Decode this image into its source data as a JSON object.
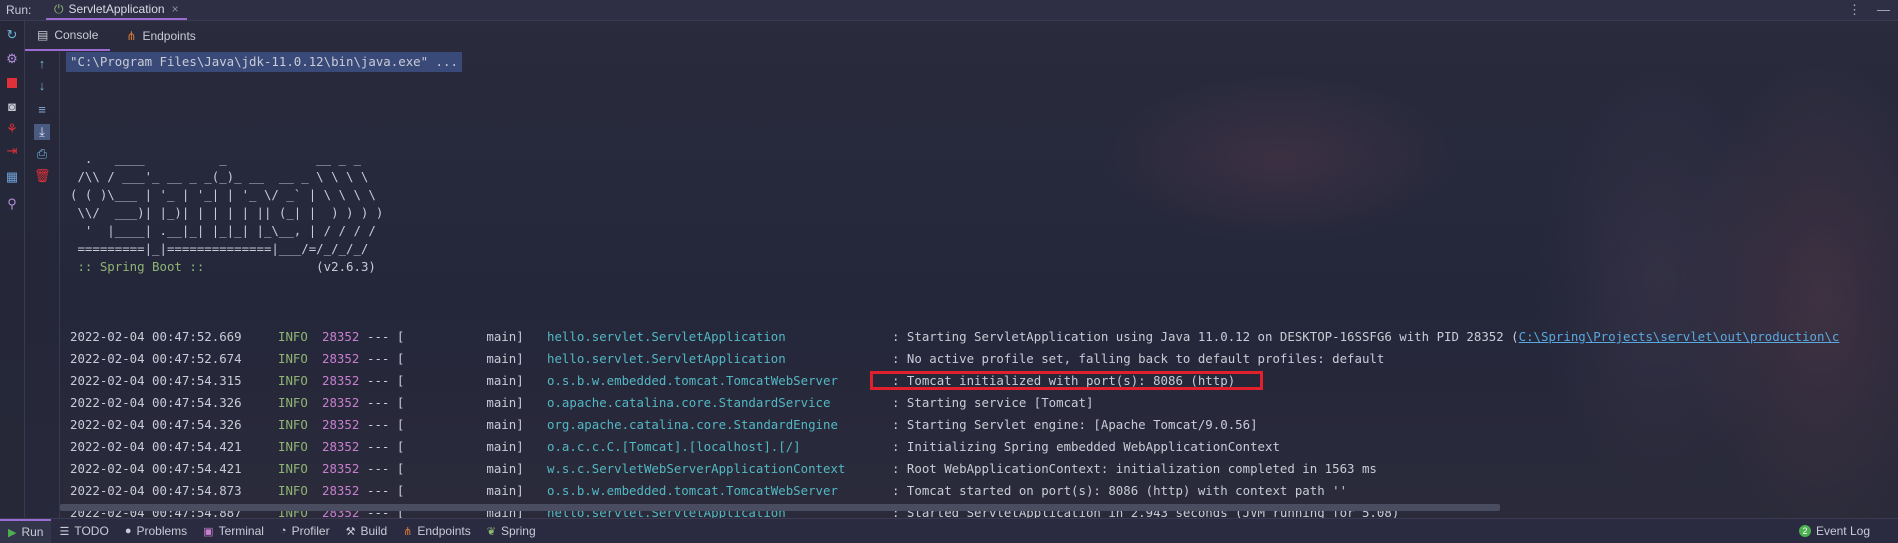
{
  "topbar": {
    "run_label": "Run:",
    "tab_title": "ServletApplication",
    "tab_close": "×",
    "menu_glyph": "⋮",
    "min_glyph": "—"
  },
  "subtabs": [
    {
      "label": "Console",
      "icon": "console-icon"
    },
    {
      "label": "Endpoints",
      "icon": "endpoints-icon"
    }
  ],
  "console": {
    "command": "\"C:\\Program Files\\Java\\jdk-11.0.12\\bin\\java.exe\" ...",
    "banner_art": "  .   ____          _            __ _ _\n /\\\\ / ___'_ __ _ _(_)_ __  __ _ \\ \\ \\ \\\n( ( )\\___ | '_ | '_| | '_ \\/ _` | \\ \\ \\ \\\n \\\\/  ___)| |_)| | | | | || (_| |  ) ) ) )\n  '  |____| .__|_| |_|_| |_\\__, | / / / /\n =========|_|==============|___/=/_/_/_/",
    "spring_label": " :: Spring Boot :: ",
    "spring_version": "              (v2.6.3)",
    "logs": [
      {
        "ts": "2022-02-04 00:47:52.669",
        "level": "INFO",
        "pid": "28352",
        "sep": "--- [           main]",
        "logger": "hello.servlet.ServletApplication",
        "msg": ": Starting ServletApplication using Java 11.0.12 on DESKTOP-16SSFG6 with PID 28352 (",
        "link": "C:\\Spring\\Projects\\servlet\\out\\production\\c"
      },
      {
        "ts": "2022-02-04 00:47:52.674",
        "level": "INFO",
        "pid": "28352",
        "sep": "--- [           main]",
        "logger": "hello.servlet.ServletApplication",
        "msg": ": No active profile set, falling back to default profiles: default"
      },
      {
        "ts": "2022-02-04 00:47:54.315",
        "level": "INFO",
        "pid": "28352",
        "sep": "--- [           main]",
        "logger": "o.s.b.w.embedded.tomcat.TomcatWebServer",
        "msg": ": Tomcat initialized with port(s): 8086 (http)"
      },
      {
        "ts": "2022-02-04 00:47:54.326",
        "level": "INFO",
        "pid": "28352",
        "sep": "--- [           main]",
        "logger": "o.apache.catalina.core.StandardService",
        "msg": ": Starting service [Tomcat]"
      },
      {
        "ts": "2022-02-04 00:47:54.326",
        "level": "INFO",
        "pid": "28352",
        "sep": "--- [           main]",
        "logger": "org.apache.catalina.core.StandardEngine",
        "msg": ": Starting Servlet engine: [Apache Tomcat/9.0.56]"
      },
      {
        "ts": "2022-02-04 00:47:54.421",
        "level": "INFO",
        "pid": "28352",
        "sep": "--- [           main]",
        "logger": "o.a.c.c.C.[Tomcat].[localhost].[/]",
        "msg": ": Initializing Spring embedded WebApplicationContext"
      },
      {
        "ts": "2022-02-04 00:47:54.421",
        "level": "INFO",
        "pid": "28352",
        "sep": "--- [           main]",
        "logger": "w.s.c.ServletWebServerApplicationContext",
        "msg": ": Root WebApplicationContext: initialization completed in 1563 ms"
      },
      {
        "ts": "2022-02-04 00:47:54.873",
        "level": "INFO",
        "pid": "28352",
        "sep": "--- [           main]",
        "logger": "o.s.b.w.embedded.tomcat.TomcatWebServer",
        "msg": ": Tomcat started on port(s): 8086 (http) with context path ''"
      },
      {
        "ts": "2022-02-04 00:47:54.887",
        "level": "INFO",
        "pid": "28352",
        "sep": "--- [           main]",
        "logger": "hello.servlet.ServletApplication",
        "msg": ": Started ServletApplication in 2.943 seconds (JVM running for 5.08)"
      }
    ]
  },
  "bottombar": {
    "tabs": [
      {
        "label": "Run",
        "icon": "run-icon",
        "glyph": "▶",
        "color": "#4caf50"
      },
      {
        "label": "TODO",
        "icon": "todo-icon",
        "glyph": "☰",
        "color": "#c9cbd6"
      },
      {
        "label": "Problems",
        "icon": "problems-icon",
        "glyph": "●",
        "color": "#c9cbd6"
      },
      {
        "label": "Terminal",
        "icon": "terminal-icon",
        "glyph": "▣",
        "color": "#c97fd0"
      },
      {
        "label": "Profiler",
        "icon": "profiler-icon",
        "glyph": "◔",
        "color": "#c9cbd6"
      },
      {
        "label": "Build",
        "icon": "build-icon",
        "glyph": "⚒",
        "color": "#c9cbd6"
      },
      {
        "label": "Endpoints",
        "icon": "endpoints-icon",
        "glyph": "⋔",
        "color": "#d97b3a"
      },
      {
        "label": "Spring",
        "icon": "spring-icon",
        "glyph": "❦",
        "color": "#8fb573"
      }
    ],
    "event_log": "Event Log",
    "event_count": "2"
  },
  "colors": {
    "accent": "#9a6bd0",
    "info": "#8fb573",
    "pid": "#c97fd0",
    "logger": "#53b8c3",
    "highlight_box": "#e0202a"
  }
}
